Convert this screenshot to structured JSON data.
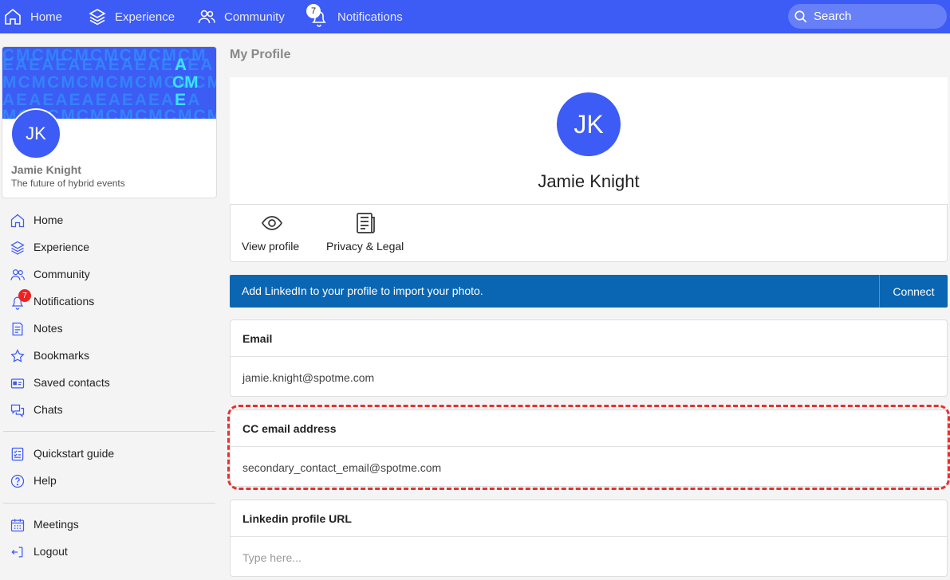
{
  "topnav": {
    "home": "Home",
    "experience": "Experience",
    "community": "Community",
    "notifications": "Notifications",
    "notifications_count": "7",
    "search_placeholder": "Search"
  },
  "profile_card": {
    "initials": "JK",
    "name": "Jamie Knight",
    "tagline": "The future of hybrid events",
    "banner_rows": [
      "CMCMCMCMCMCMCM",
      "EAEAEAEAEAEAEAEA",
      "MCMCMCMCMCMCMCM",
      "AEAEAEAEAEAEAEA",
      "MCMCMCMCMCMCMCM"
    ],
    "banner_highlight": [
      "A",
      "CM",
      "E"
    ]
  },
  "sidebar": {
    "items": [
      {
        "label": "Home"
      },
      {
        "label": "Experience"
      },
      {
        "label": "Community"
      },
      {
        "label": "Notifications",
        "badge": "7"
      },
      {
        "label": "Notes"
      },
      {
        "label": "Bookmarks"
      },
      {
        "label": "Saved contacts"
      },
      {
        "label": "Chats"
      }
    ],
    "secondary": [
      {
        "label": "Quickstart guide"
      },
      {
        "label": "Help"
      }
    ],
    "tertiary": [
      {
        "label": "Meetings"
      },
      {
        "label": "Logout"
      }
    ]
  },
  "main": {
    "page_title": "My Profile",
    "initials": "JK",
    "name": "Jamie Knight",
    "actions": [
      {
        "label": "View profile",
        "icon": "eye-icon"
      },
      {
        "label": "Privacy & Legal",
        "icon": "document-icon"
      }
    ],
    "linkedin": {
      "text": "Add LinkedIn to your profile to import your photo.",
      "button": "Connect"
    },
    "fields": [
      {
        "label": "Email",
        "value": "jamie.knight@spotme.com"
      },
      {
        "label": "CC email address",
        "value": "secondary_contact_email@spotme.com"
      },
      {
        "label": "Linkedin profile URL",
        "placeholder": "Type here..."
      }
    ]
  },
  "colors": {
    "brand": "#3d5bf5",
    "linkedin": "#0a66b2",
    "badge": "#e22222",
    "highlight": "#e8312f"
  }
}
